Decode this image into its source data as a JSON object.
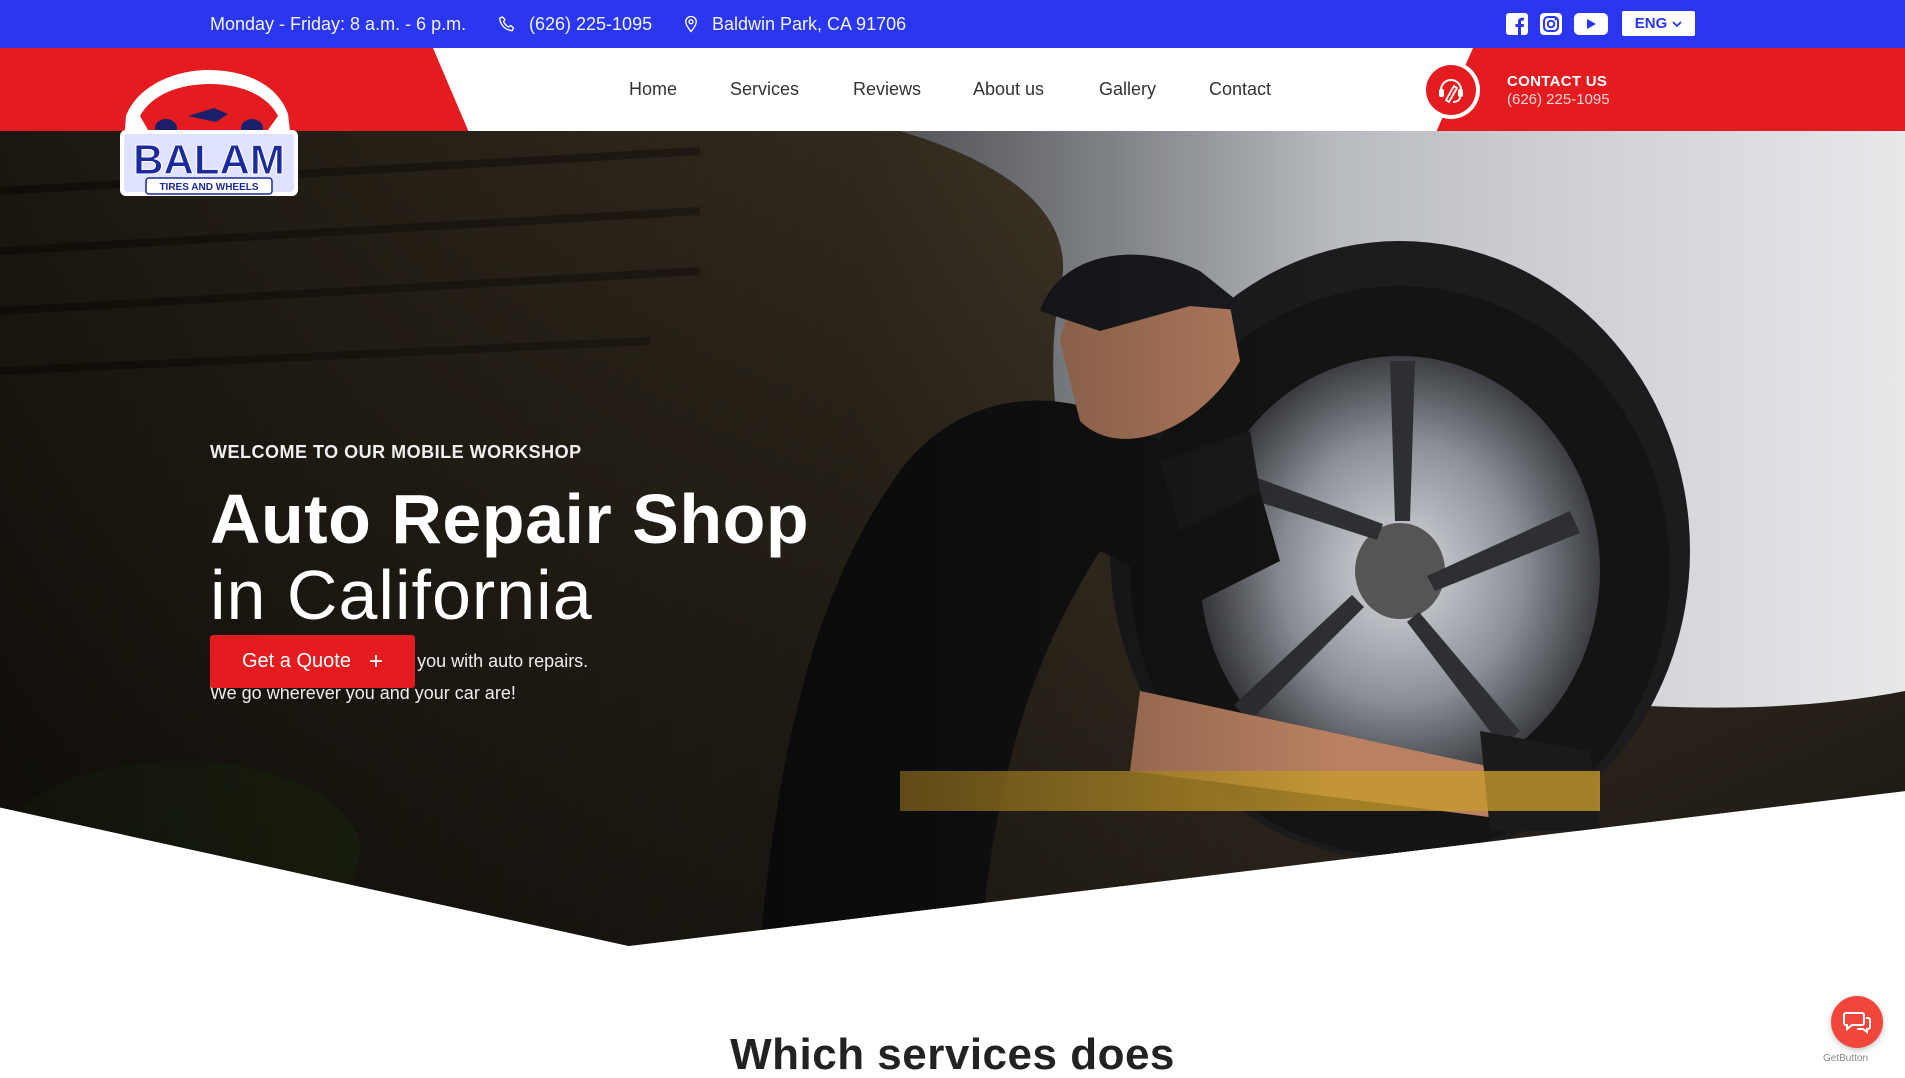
{
  "topbar": {
    "hours": "Monday - Friday: 8 a.m. - 6 p.m.",
    "phone": "(626) 225-1095",
    "address": "Baldwin Park, CA 91706",
    "language": "ENG",
    "social_icons": [
      "facebook-icon",
      "instagram-icon",
      "youtube-icon"
    ]
  },
  "logo": {
    "name": "BALAM",
    "tagline": "TIRES AND WHEELS"
  },
  "nav": {
    "items": [
      {
        "label": "Home",
        "active": true
      },
      {
        "label": "Services"
      },
      {
        "label": "Reviews"
      },
      {
        "label": "About us"
      },
      {
        "label": "Gallery"
      },
      {
        "label": "Contact"
      }
    ]
  },
  "contact": {
    "title": "CONTACT US",
    "phone": "(626) 225-1095"
  },
  "hero": {
    "kicker": "WELCOME TO OUR MOBILE WORKSHOP",
    "title_line1": "Auto Repair Shop",
    "title_line2": "in California",
    "lead_line1": "Our team is ready to help you with auto repairs.",
    "lead_line2": "We go wherever you and your car are!",
    "cta_label": "Get a Quote",
    "cta_icon": "+"
  },
  "section": {
    "title": "Which services does"
  },
  "widget": {
    "chat_icon": "chat-icon",
    "credit": "GetButton"
  },
  "colors": {
    "blue": "#2a36f0",
    "red": "#e41c20",
    "white": "#ffffff"
  }
}
